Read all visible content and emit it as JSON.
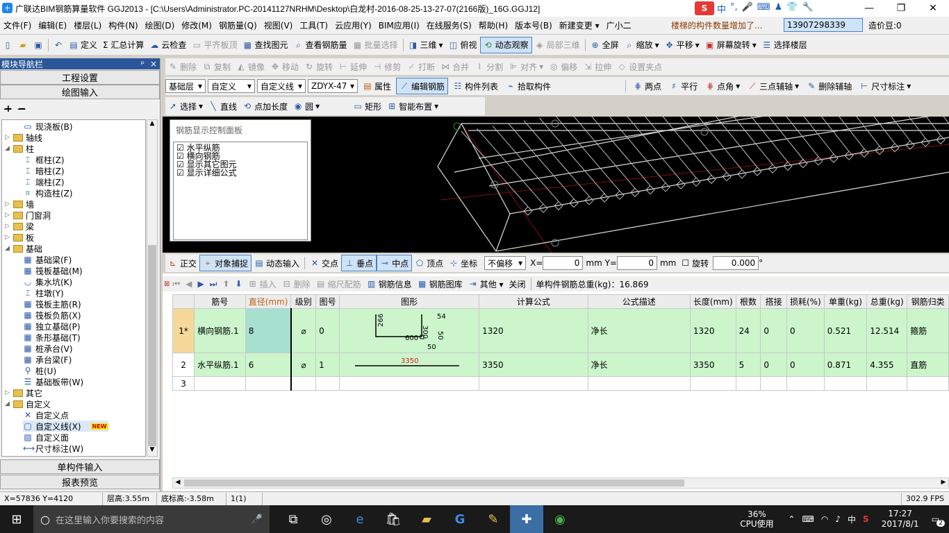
{
  "window": {
    "title": "广联达BIM钢筋算量软件 GGJ2013 - [C:\\Users\\Administrator.PC-20141127NRHM\\Desktop\\白龙村-2016-08-25-13-27-07(2166版)_16G.GGJ12]",
    "minimize": "—",
    "maximize": "❐",
    "close": "✕"
  },
  "ime": [
    "中",
    "°,",
    "🎤",
    "⌨",
    "♟",
    "👕",
    "🔧"
  ],
  "menu": [
    "文件(F)",
    "编辑(E)",
    "楼层(L)",
    "构件(N)",
    "绘图(D)",
    "修改(M)",
    "钢筋量(Q)",
    "视图(V)",
    "工具(T)",
    "云应用(Y)",
    "BIM应用(I)",
    "在线服务(S)",
    "帮助(H)",
    "版本号(B)",
    "新建变更 ▾",
    "广小二"
  ],
  "notice": "楼梯的构件数量增加了...",
  "account": "13907298339",
  "price": "造价豆:0",
  "toolbar1": [
    "定义",
    "Σ 汇总计算",
    "云检查",
    "平齐板顶",
    "查找图元",
    "查看钢筋量",
    "批量选择",
    "三维",
    "俯视",
    "动态观察",
    "局部三维",
    "全屏",
    "缩放",
    "平移",
    "屏幕旋转",
    "选择楼层"
  ],
  "toolbar2": [
    "删除",
    "复制",
    "镜像",
    "移动",
    "旋转",
    "延伸",
    "修剪",
    "打断",
    "合并",
    "分割",
    "对齐",
    "偏移",
    "拉伸",
    "设置夹点"
  ],
  "toolbar3": {
    "floor": "基础层",
    "type": "自定义",
    "sub": "自定义线",
    "code": "ZDYX-47",
    "buttons": [
      "属性",
      "编辑钢筋",
      "构件列表",
      "拾取构件",
      "两点",
      "平行",
      "点角",
      "三点辅轴",
      "删除辅轴",
      "尺寸标注"
    ]
  },
  "toolbar4": [
    "选择",
    "直线",
    "点加长度",
    "圆",
    "矩形",
    "智能布置"
  ],
  "leftpanel": {
    "title": "模块导航栏",
    "pin": "ᵖ",
    "close": "×",
    "btn_project": "工程设置",
    "btn_draw": "绘图输入",
    "btn_single": "单构件输入",
    "btn_report": "报表预览",
    "tree": [
      {
        "t": "现浇板(B)",
        "lvl": 2,
        "ic": "▭"
      },
      {
        "t": "轴线",
        "lvl": 0,
        "folder": true,
        "tw": "▷"
      },
      {
        "t": "柱",
        "lvl": 0,
        "folder": true,
        "tw": "◢"
      },
      {
        "t": "框柱(Z)",
        "lvl": 2,
        "ic": "⌶"
      },
      {
        "t": "暗柱(Z)",
        "lvl": 2,
        "ic": "⌶"
      },
      {
        "t": "端柱(Z)",
        "lvl": 2,
        "ic": "⌶"
      },
      {
        "t": "构造柱(Z)",
        "lvl": 2,
        "ic": "⌗"
      },
      {
        "t": "墙",
        "lvl": 0,
        "folder": true,
        "tw": "▷"
      },
      {
        "t": "门窗洞",
        "lvl": 0,
        "folder": true,
        "tw": "▷"
      },
      {
        "t": "梁",
        "lvl": 0,
        "folder": true,
        "tw": "▷"
      },
      {
        "t": "板",
        "lvl": 0,
        "folder": true,
        "tw": "▷"
      },
      {
        "t": "基础",
        "lvl": 0,
        "folder": true,
        "tw": "◢"
      },
      {
        "t": "基础梁(F)",
        "lvl": 2,
        "ic": "▦"
      },
      {
        "t": "筏板基础(M)",
        "lvl": 2,
        "ic": "▦"
      },
      {
        "t": "集水坑(K)",
        "lvl": 2,
        "ic": "◡"
      },
      {
        "t": "柱墩(Y)",
        "lvl": 2,
        "ic": "⌶"
      },
      {
        "t": "筏板主筋(R)",
        "lvl": 2,
        "ic": "▦"
      },
      {
        "t": "筏板负筋(X)",
        "lvl": 2,
        "ic": "▦"
      },
      {
        "t": "独立基础(P)",
        "lvl": 2,
        "ic": "▦"
      },
      {
        "t": "条形基础(T)",
        "lvl": 2,
        "ic": "▦"
      },
      {
        "t": "桩承台(V)",
        "lvl": 2,
        "ic": "▦"
      },
      {
        "t": "承台梁(F)",
        "lvl": 2,
        "ic": "▦"
      },
      {
        "t": "桩(U)",
        "lvl": 2,
        "ic": "⚲"
      },
      {
        "t": "基础板带(W)",
        "lvl": 2,
        "ic": "☰"
      },
      {
        "t": "其它",
        "lvl": 0,
        "folder": true,
        "tw": "▷"
      },
      {
        "t": "自定义",
        "lvl": 0,
        "folder": true,
        "tw": "◢"
      },
      {
        "t": "自定义点",
        "lvl": 2,
        "ic": "✕"
      },
      {
        "t": "自定义线(X)",
        "lvl": 2,
        "ic": "▢"
      },
      {
        "t": "自定义面",
        "lvl": 2,
        "ic": "▨"
      },
      {
        "t": "尺寸标注(W)",
        "lvl": 2,
        "ic": "⟷"
      }
    ],
    "new_badge": "NEW"
  },
  "ctrlpanel": {
    "title": "钢筋显示控制面板",
    "items": [
      "水平纵筋",
      "横向钢筋",
      "显示其它图元",
      "显示详细公式"
    ]
  },
  "snapbar": {
    "items": [
      "正交",
      "对象捕捉",
      "动态输入",
      "交点",
      "垂点",
      "中点",
      "顶点",
      "坐标"
    ],
    "offset": "不偏移",
    "x_label": "X=",
    "x": "0",
    "y_label": "mm Y=",
    "y": "0",
    "mm": "mm",
    "rotate": "旋转",
    "rot": "0.000",
    "deg": "°"
  },
  "gridtool": {
    "buttons": [
      "插入",
      "删除",
      "缩尺配筋",
      "钢筋信息",
      "钢筋图库",
      "其他 ▾",
      "关闭"
    ],
    "total": "单构件钢筋总重(kg)：16.869"
  },
  "table": {
    "headers": [
      "",
      "筋号",
      "直径(mm)",
      "级别",
      "图号",
      "图形",
      "计算公式",
      "公式描述",
      "长度(mm)",
      "根数",
      "搭接",
      "损耗(%)",
      "单重(kg)",
      "总重(kg)",
      "钢筋归类"
    ],
    "rows": [
      [
        "1*",
        "横向钢筋.1",
        "8",
        "⌀",
        "0",
        "",
        "1320",
        "净长",
        "1320",
        "24",
        "0",
        "0",
        "0.521",
        "12.514",
        "箍筋"
      ],
      [
        "2",
        "水平纵筋.1",
        "6",
        "⌀",
        "1",
        "",
        "3350",
        "净长",
        "3350",
        "5",
        "0",
        "0",
        "0.871",
        "4.355",
        "直筋"
      ],
      [
        "3",
        "",
        "",
        "",
        "",
        "",
        "",
        "",
        "",
        "",
        "",
        "",
        "",
        "",
        ""
      ]
    ],
    "shape1": {
      "a": "266",
      "b": "300",
      "c": "54",
      "d": "600",
      "e": "50",
      "f": "50"
    },
    "shape2": "3350"
  },
  "status": [
    "X=57836 Y=4120",
    "层高:3.55m",
    "底标高:-3.58m",
    "1(1)",
    "",
    "302.9 FPS"
  ],
  "taskbar": {
    "search": "在这里输入你要搜索的内容",
    "cpu": "36%",
    "cpu_label": "CPU使用",
    "time": "17:27",
    "date": "2017/8/1",
    "lang": "中",
    "notif": "2"
  }
}
